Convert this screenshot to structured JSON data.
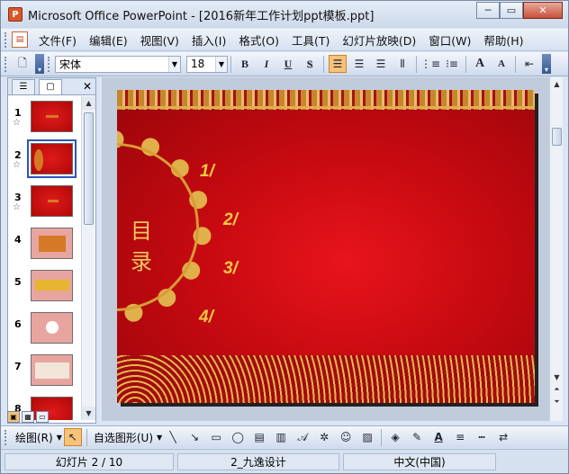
{
  "window": {
    "app_icon": "P",
    "title": "Microsoft Office PowerPoint - [2016新年工作计划ppt模板.ppt]",
    "minimize": "─",
    "restore": "▭",
    "close": "✕"
  },
  "menu": {
    "items": [
      "文件(F)",
      "编辑(E)",
      "视图(V)",
      "插入(I)",
      "格式(O)",
      "工具(T)",
      "幻灯片放映(D)",
      "窗口(W)",
      "帮助(H)"
    ]
  },
  "toolbar": {
    "font_name": "宋体",
    "font_size": "18",
    "bold": "B",
    "italic": "I",
    "underline": "U",
    "shadow": "S",
    "grow_font": "A",
    "shrink_font": "A"
  },
  "left_pane": {
    "close": "✕",
    "slides": [
      {
        "number": "1",
        "star": "☆"
      },
      {
        "number": "2",
        "star": "☆"
      },
      {
        "number": "3",
        "star": "☆"
      },
      {
        "number": "4",
        "star": ""
      },
      {
        "number": "5",
        "star": ""
      },
      {
        "number": "6",
        "star": ""
      },
      {
        "number": "7",
        "star": ""
      },
      {
        "number": "8",
        "star": ""
      }
    ]
  },
  "slide": {
    "toc_title": "目录",
    "items": [
      "1/",
      "2/",
      "3/",
      "4/"
    ]
  },
  "drawing_toolbar": {
    "draw_label": "绘图(R)",
    "autoshapes_label": "自选图形(U)"
  },
  "status": {
    "slide_position": "幻灯片 2 / 10",
    "design": "2_九逸设计",
    "language": "中文(中国)"
  },
  "colors": {
    "slide_red": "#d20c13",
    "gold": "#f6c944"
  }
}
